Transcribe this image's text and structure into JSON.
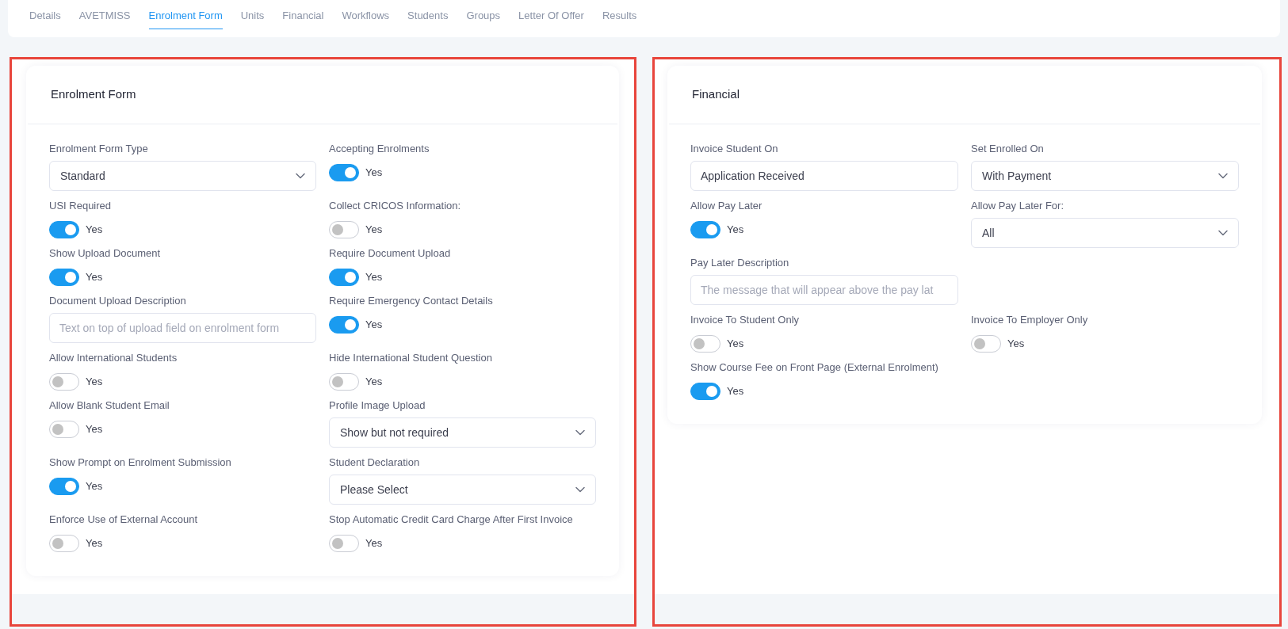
{
  "tabs": [
    {
      "label": "Details",
      "selected": false
    },
    {
      "label": "AVETMISS",
      "selected": false
    },
    {
      "label": "Enrolment Form",
      "selected": true
    },
    {
      "label": "Units",
      "selected": false
    },
    {
      "label": "Financial",
      "selected": false
    },
    {
      "label": "Workflows",
      "selected": false
    },
    {
      "label": "Students",
      "selected": false
    },
    {
      "label": "Groups",
      "selected": false
    },
    {
      "label": "Letter Of Offer",
      "selected": false
    },
    {
      "label": "Results",
      "selected": false
    }
  ],
  "panels": [
    {
      "title": "Enrolment Form",
      "rows": [
        [
          {
            "kind": "select",
            "label": "Enrolment Form Type",
            "value": "Standard"
          },
          {
            "kind": "toggle",
            "label": "Accepting Enrolments",
            "on": true,
            "text": "Yes"
          }
        ],
        [
          {
            "kind": "toggle",
            "label": "USI Required",
            "on": true,
            "text": "Yes"
          },
          {
            "kind": "toggle",
            "label": "Collect CRICOS Information:",
            "on": false,
            "text": "Yes"
          }
        ],
        [
          {
            "kind": "toggle",
            "label": "Show Upload Document",
            "on": true,
            "text": "Yes"
          },
          {
            "kind": "toggle",
            "label": "Require Document Upload",
            "on": true,
            "text": "Yes"
          }
        ],
        [
          {
            "kind": "text",
            "label": "Document Upload Description",
            "placeholder": "Text on top of upload field on enrolment form"
          },
          {
            "kind": "toggle",
            "label": "Require Emergency Contact Details",
            "on": true,
            "text": "Yes"
          }
        ],
        [
          {
            "kind": "toggle",
            "label": "Allow International Students",
            "on": false,
            "text": "Yes"
          },
          {
            "kind": "toggle",
            "label": "Hide International Student Question",
            "on": false,
            "text": "Yes"
          }
        ],
        [
          {
            "kind": "toggle",
            "label": "Allow Blank Student Email",
            "on": false,
            "text": "Yes"
          },
          {
            "kind": "select",
            "label": "Profile Image Upload",
            "value": "Show but not required"
          }
        ],
        [
          {
            "kind": "toggle",
            "label": "Show Prompt on Enrolment Submission",
            "on": true,
            "text": "Yes"
          },
          {
            "kind": "select",
            "label": "Student Declaration",
            "value": "Please Select"
          }
        ],
        [
          {
            "kind": "toggle",
            "label": "Enforce Use of External Account",
            "on": false,
            "text": "Yes"
          },
          {
            "kind": "toggle",
            "label": "Stop Automatic Credit Card Charge After First Invoice",
            "on": false,
            "text": "Yes"
          }
        ]
      ]
    },
    {
      "title": "Financial",
      "rows": [
        [
          {
            "kind": "text",
            "label": "Invoice Student On",
            "value": "Application Received"
          },
          {
            "kind": "select",
            "label": "Set Enrolled On",
            "value": "With Payment"
          }
        ],
        [
          {
            "kind": "toggle",
            "label": "Allow Pay Later",
            "on": true,
            "text": "Yes"
          },
          {
            "kind": "select",
            "label": "Allow Pay Later For:",
            "value": "All"
          }
        ],
        [
          {
            "kind": "text",
            "label": "Pay Later Description",
            "placeholder": "The message that will appear above the pay lat"
          }
        ],
        [
          {
            "kind": "toggle",
            "label": "Invoice To Student Only",
            "on": false,
            "text": "Yes"
          },
          {
            "kind": "toggle",
            "label": "Invoice To Employer Only",
            "on": false,
            "text": "Yes"
          }
        ],
        [
          {
            "kind": "toggle",
            "label": "Show Course Fee on Front Page (External Enrolment)",
            "on": true,
            "text": "Yes"
          }
        ]
      ]
    }
  ]
}
